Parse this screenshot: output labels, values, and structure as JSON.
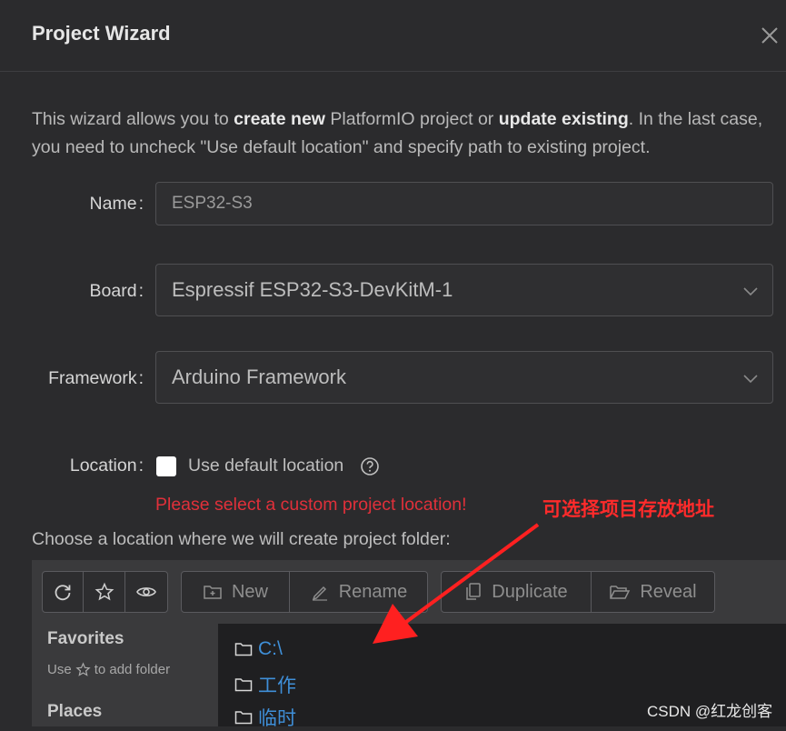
{
  "dialog": {
    "title": "Project Wizard",
    "intro": {
      "part1": "This wizard allows you to ",
      "bold1": "create new",
      "part2": " PlatformIO project or ",
      "bold2": "update existing",
      "part3": ". In the last case, you need to uncheck \"Use default location\" and specify path to existing project."
    }
  },
  "form": {
    "name_label": "Name",
    "name_value": "ESP32-S3",
    "board_label": "Board",
    "board_value": "Espressif ESP32-S3-DevKitM-1",
    "framework_label": "Framework",
    "framework_value": "Arduino Framework",
    "location_label": "Location",
    "colon": ":",
    "use_default_label": "Use default location",
    "error": "Please select a custom project location!",
    "choose_text": "Choose a location where we will create project folder:"
  },
  "annotation": "可选择项目存放地址",
  "toolbar": {
    "new_label": "New",
    "rename_label": "Rename",
    "duplicate_label": "Duplicate",
    "reveal_label": "Reveal"
  },
  "sidebar": {
    "favorites_title": "Favorites",
    "favorites_hint_1": "Use",
    "favorites_hint_2": "to add folder",
    "places_title": "Places"
  },
  "folders": [
    "C:\\",
    "工作",
    "临时"
  ],
  "watermark": "CSDN @红龙创客",
  "colors": {
    "background": "#2b2b2d",
    "error": "#e0303a",
    "link": "#3f8fd8",
    "annotation": "#ff2b2b"
  }
}
